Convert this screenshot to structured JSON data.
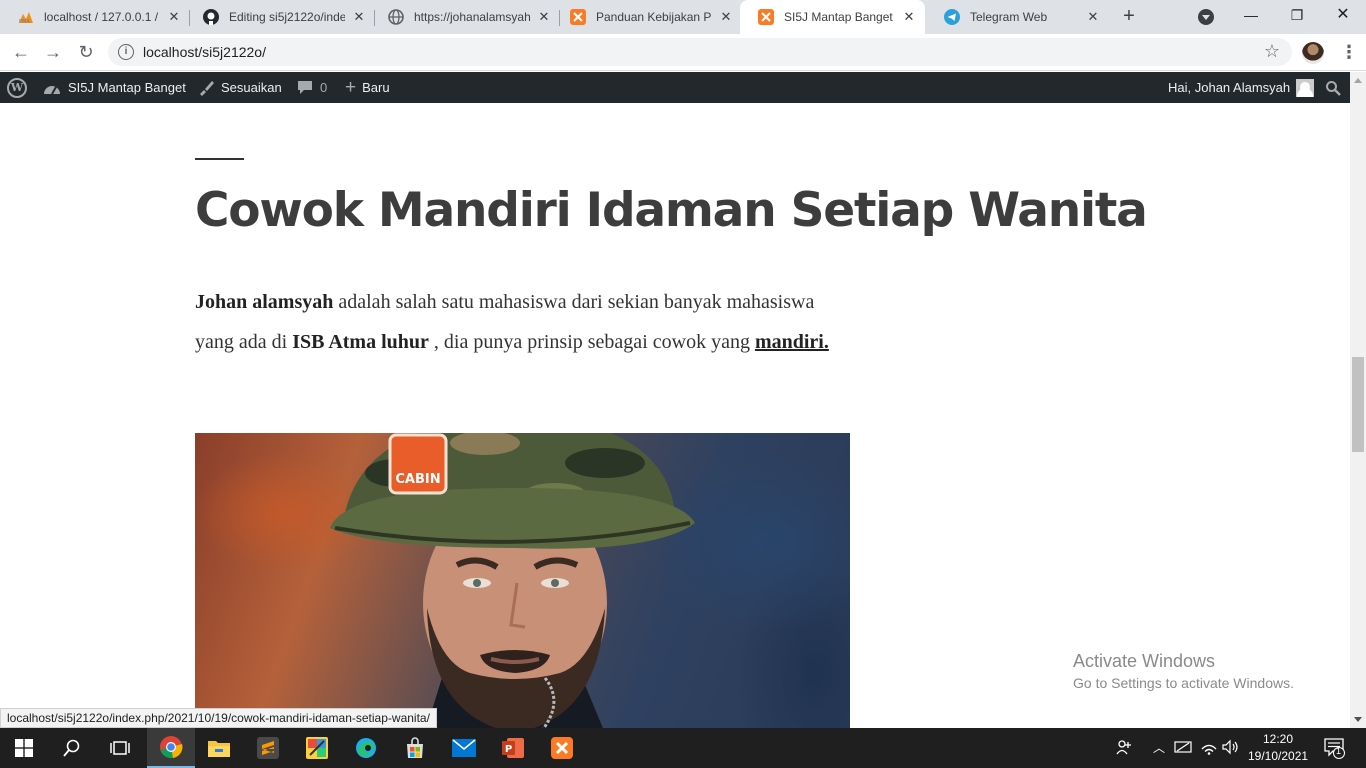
{
  "browser": {
    "tabs": [
      {
        "title": "localhost / 127.0.0.1 / ...",
        "icon": "phpmyadmin-icon",
        "active": false
      },
      {
        "title": "Editing si5j2122o/inde",
        "icon": "github-icon",
        "active": false
      },
      {
        "title": "https://johanalamsyah",
        "icon": "globe-icon",
        "active": false
      },
      {
        "title": "Panduan Kebijakan Pri",
        "icon": "xampp-icon",
        "active": false
      },
      {
        "title": "SI5J Mantap Banget –",
        "icon": "xampp-icon",
        "active": true
      },
      {
        "title": "Telegram Web",
        "icon": "telegram-icon",
        "active": false
      }
    ],
    "address": "localhost/si5j2122o/",
    "status_url": "localhost/si5j2122o/index.php/2021/10/19/cowok-mandiri-idaman-setiap-wanita/"
  },
  "wp_admin_bar": {
    "site_name": "SI5J Mantap Banget",
    "customize": "Sesuaikan",
    "comments_count": "0",
    "new": "Baru",
    "greeting": "Hai, Johan Alamsyah"
  },
  "post": {
    "title": "Cowok Mandiri Idaman Setiap Wanita",
    "paragraph": {
      "strong1": "Johan alamsyah",
      "text1": " adalah salah satu mahasiswa dari sekian banyak mahasiswa yang ada di ",
      "strong2": "ISB Atma luhur",
      "text2": " , dia punya prinsip sebagai cowok yang ",
      "link": "mandiri."
    },
    "image_alt": "photo of man wearing camo cap"
  },
  "watermark": {
    "line1": "Activate Windows",
    "line2": "Go to Settings to activate Windows."
  },
  "taskbar": {
    "time": "12:20",
    "date": "19/10/2021",
    "notifications": "1",
    "apps": [
      "start-icon",
      "search-icon",
      "task-view-icon",
      "chrome-icon",
      "file-explorer-icon",
      "sublime-text-icon",
      "paint-icon",
      "edge-icon",
      "store-icon",
      "mail-icon",
      "powerpoint-icon",
      "xampp-icon"
    ]
  },
  "colors": {
    "wp_bar": "#23282d",
    "tab_strip": "#dee1e6",
    "taskbar": "#1f1f1f",
    "title_text": "#3d3d3d"
  }
}
